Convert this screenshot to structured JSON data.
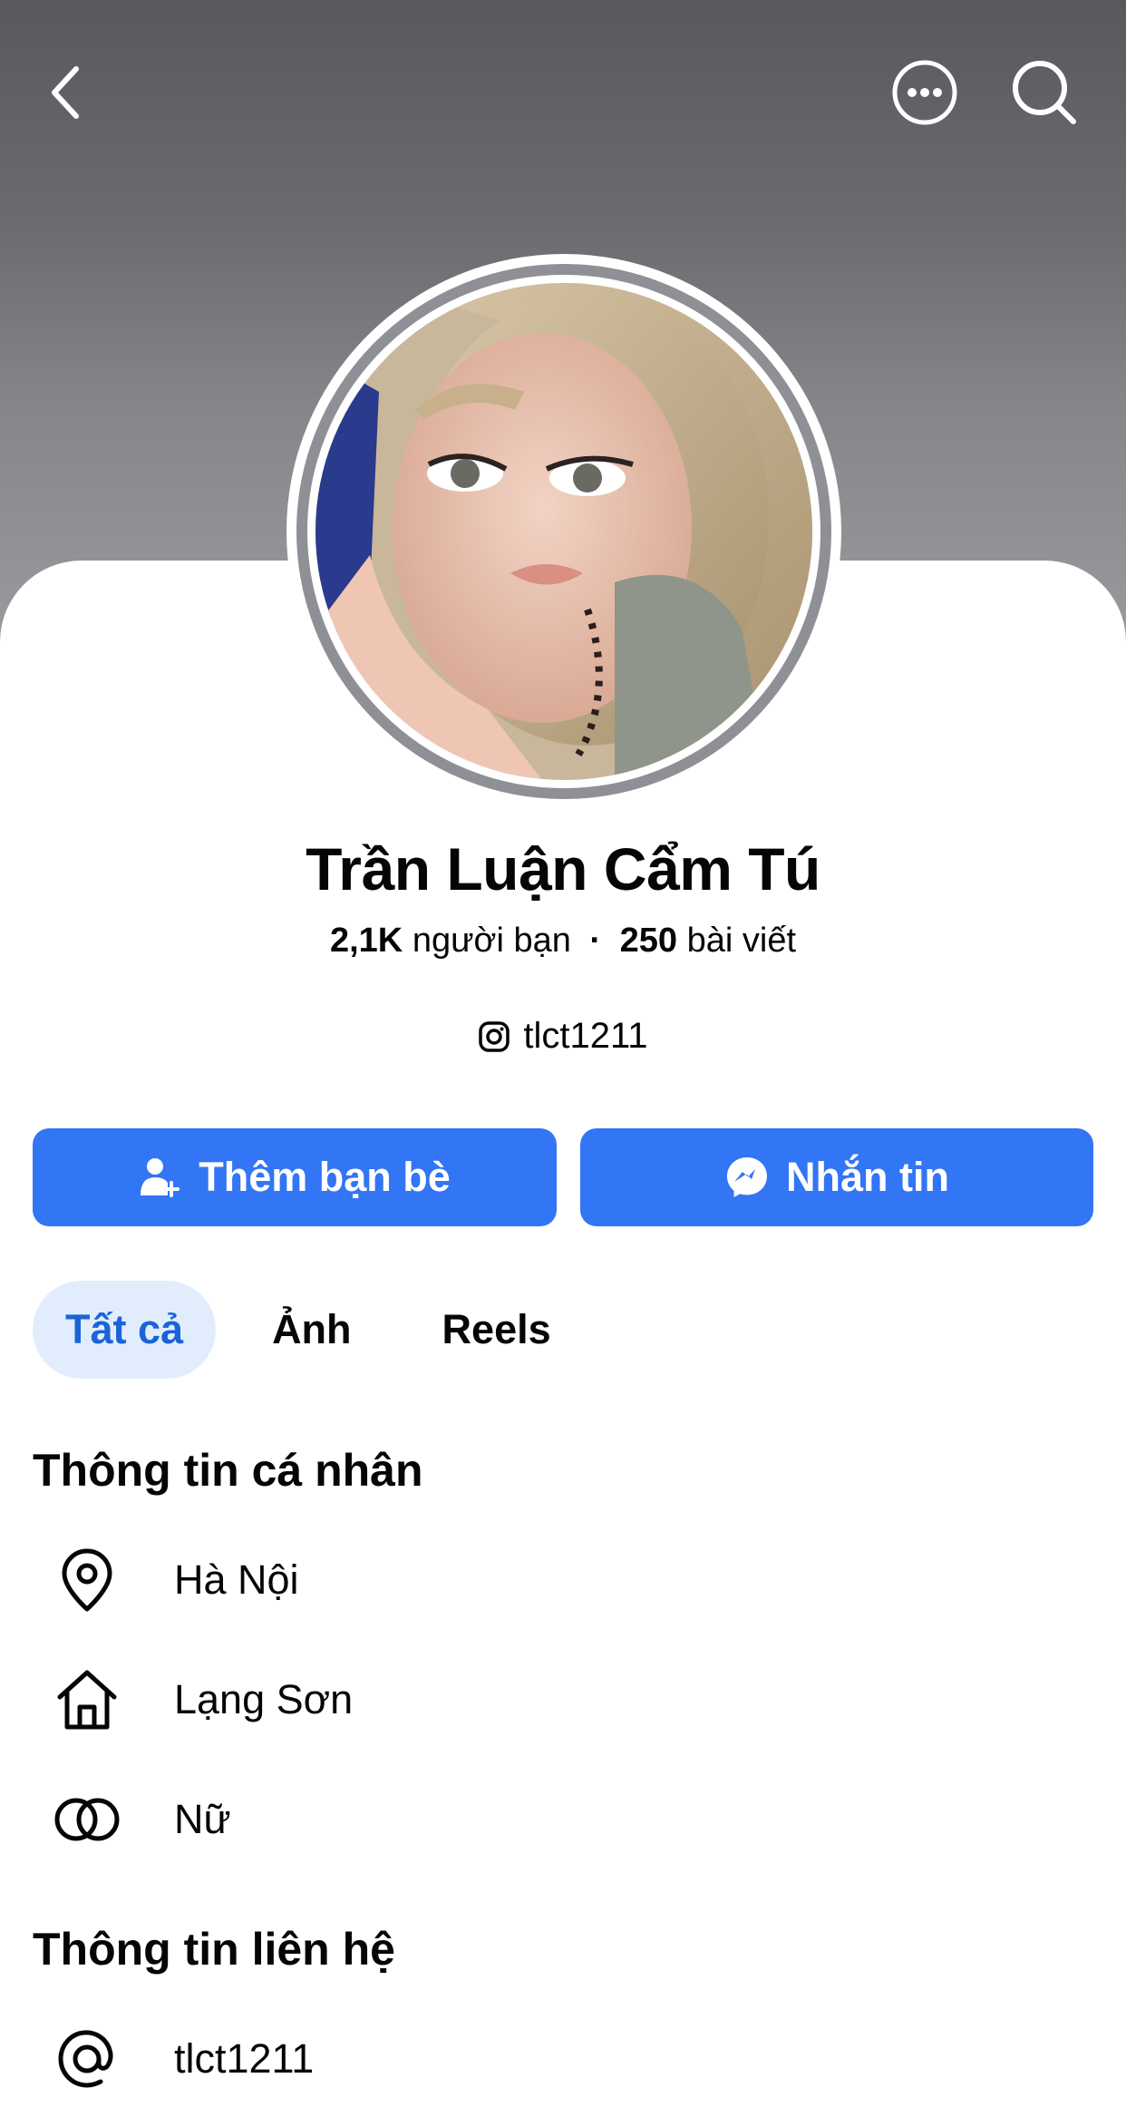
{
  "header": {
    "back_icon": "chevron-left-icon",
    "more_icon": "more-circle-icon",
    "search_icon": "search-icon"
  },
  "profile": {
    "name": "Trần Luận Cẩm Tú",
    "friends": "2,1K",
    "friends_label": "người bạn",
    "posts": "250",
    "posts_label": "bài viết",
    "instagram_handle": "tlct1211"
  },
  "actions": {
    "add_friend_label": "Thêm bạn bè",
    "message_label": "Nhắn tin"
  },
  "tabs": [
    {
      "label": "Tất cả",
      "active": true
    },
    {
      "label": "Ảnh",
      "active": false
    },
    {
      "label": "Reels",
      "active": false
    }
  ],
  "personal_info": {
    "title": "Thông tin cá nhân",
    "items": [
      {
        "icon": "location-pin-icon",
        "text": "Hà Nội"
      },
      {
        "icon": "home-icon",
        "text": "Lạng Sơn"
      },
      {
        "icon": "gender-icon",
        "text": "Nữ"
      }
    ]
  },
  "contact_info": {
    "title": "Thông tin liên hệ",
    "items": [
      {
        "icon": "at-sign-icon",
        "text": "tlct1211"
      }
    ]
  },
  "colors": {
    "primary_button": "#3275f5",
    "active_tab_bg": "#e1edfd",
    "active_tab_text": "#1b64d8"
  }
}
